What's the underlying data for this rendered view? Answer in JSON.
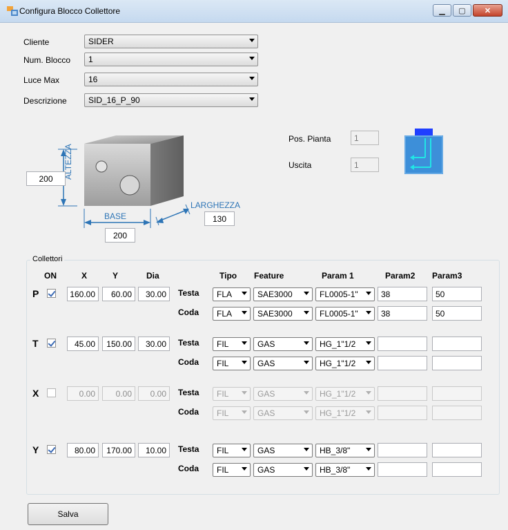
{
  "window": {
    "title": "Configura Blocco Collettore"
  },
  "form": {
    "cliente": {
      "label": "Cliente",
      "value": "SIDER"
    },
    "num_blocco": {
      "label": "Num. Blocco",
      "value": "1"
    },
    "luce_max": {
      "label": "Luce Max",
      "value": "16"
    },
    "descrizione": {
      "label": "Descrizione",
      "value": "SID_16_P_90"
    }
  },
  "diagram": {
    "altezza_label": "ALTEZZA",
    "base_label": "BASE",
    "larghezza_label": "LARGHEZZA",
    "altezza_value": "200",
    "base_value": "200",
    "larghezza_value": "130"
  },
  "position": {
    "pos_pianta": {
      "label": "Pos. Pianta",
      "value": "1"
    },
    "uscita": {
      "label": "Uscita",
      "value": "1"
    }
  },
  "collettori": {
    "group_title": "Collettori",
    "headers": {
      "on": "ON",
      "x": "X",
      "y": "Y",
      "dia": "Dia",
      "tipo": "Tipo",
      "feature": "Feature",
      "param1": "Param 1",
      "param2": "Param2",
      "param3": "Param3"
    },
    "side_labels": {
      "testa": "Testa",
      "coda": "Coda"
    },
    "rows": [
      {
        "letter": "P",
        "on": true,
        "x": "160.00",
        "y": "60.00",
        "dia": "30.00",
        "testa": {
          "tipo": "FLA",
          "feature": "SAE3000",
          "param1": "FL0005-1\"",
          "param2": "38",
          "param3": "50"
        },
        "coda": {
          "tipo": "FLA",
          "feature": "SAE3000",
          "param1": "FL0005-1\"",
          "param2": "38",
          "param3": "50"
        }
      },
      {
        "letter": "T",
        "on": true,
        "x": "45.00",
        "y": "150.00",
        "dia": "30.00",
        "testa": {
          "tipo": "FIL",
          "feature": "GAS",
          "param1": "HG_1\"1/2",
          "param2": "",
          "param3": ""
        },
        "coda": {
          "tipo": "FIL",
          "feature": "GAS",
          "param1": "HG_1\"1/2",
          "param2": "",
          "param3": ""
        }
      },
      {
        "letter": "X",
        "on": false,
        "x": "0.00",
        "y": "0.00",
        "dia": "0.00",
        "testa": {
          "tipo": "FIL",
          "feature": "GAS",
          "param1": "HG_1\"1/2",
          "param2": "",
          "param3": ""
        },
        "coda": {
          "tipo": "FIL",
          "feature": "GAS",
          "param1": "HG_1\"1/2",
          "param2": "",
          "param3": ""
        }
      },
      {
        "letter": "Y",
        "on": true,
        "x": "80.00",
        "y": "170.00",
        "dia": "10.00",
        "testa": {
          "tipo": "FIL",
          "feature": "GAS",
          "param1": "HB_3/8\"",
          "param2": "",
          "param3": ""
        },
        "coda": {
          "tipo": "FIL",
          "feature": "GAS",
          "param1": "HB_3/8\"",
          "param2": "",
          "param3": ""
        }
      }
    ]
  },
  "actions": {
    "save": "Salva"
  },
  "colors": {
    "accent": "#2e75b6",
    "preview_block": "#3d8fd9",
    "preview_cap": "#1f3fff",
    "preview_arrow": "#22e5e5"
  },
  "icons": [
    "app-icon",
    "minimize-icon",
    "maximize-icon",
    "close-icon",
    "dropdown-arrow-icon",
    "checkbox-icon"
  ]
}
